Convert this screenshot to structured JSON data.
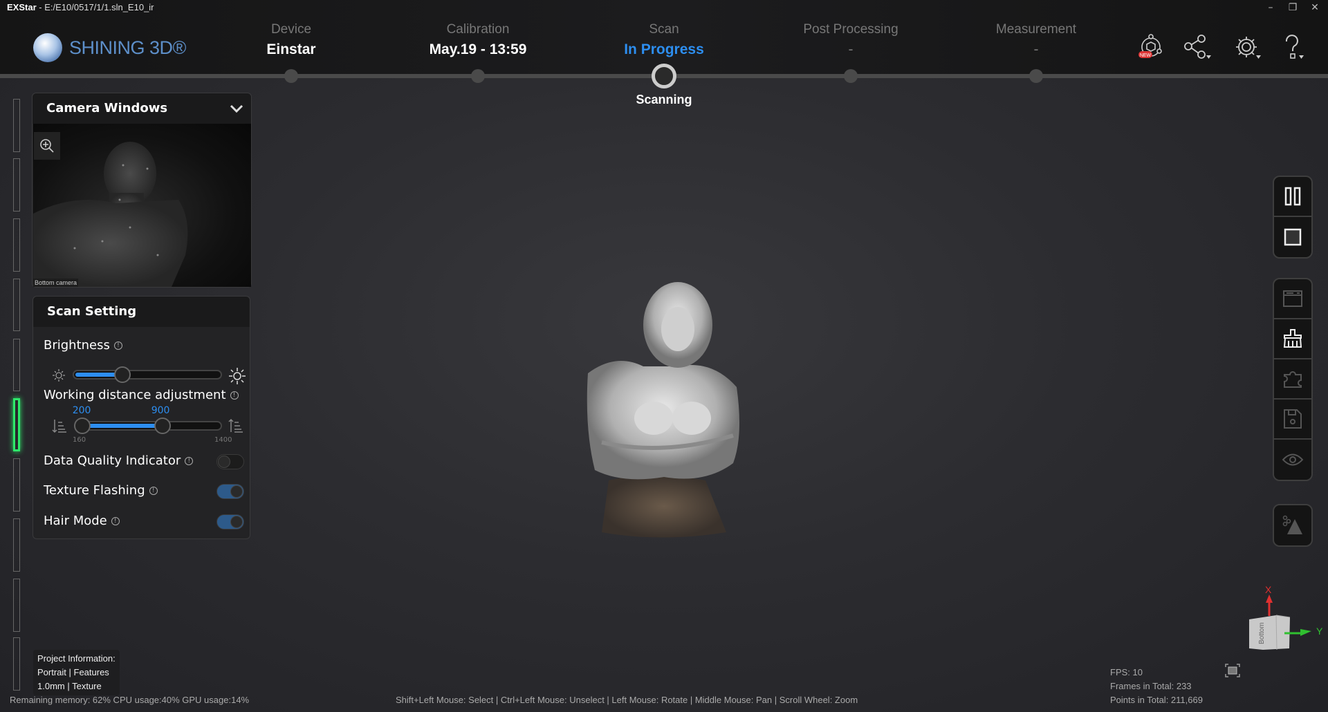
{
  "window": {
    "app": "EXStar",
    "separator": "-",
    "path": "E:/E10/0517/1/1.sln_E10_ir",
    "minimize": "–",
    "restore": "❐",
    "close": "✕"
  },
  "logo": {
    "text": "SHINING 3D®"
  },
  "steps": [
    {
      "label": "Device",
      "value": "Einstar"
    },
    {
      "label": "Calibration",
      "value": "May.19 - 13:59"
    },
    {
      "label": "Scan",
      "value": "In Progress",
      "sub": "Scanning"
    },
    {
      "label": "Post Processing",
      "value": "-"
    },
    {
      "label": "Measurement",
      "value": "-"
    }
  ],
  "toolbar": {
    "new_badge": "NEW",
    "icons": [
      "new-features-icon",
      "share-icon",
      "settings-icon",
      "help-icon"
    ]
  },
  "camera": {
    "title": "Camera Windows",
    "caption": "Bottom camera"
  },
  "scan_setting": {
    "title": "Scan Setting",
    "brightness": {
      "label": "Brightness",
      "value_fraction": 0.33
    },
    "working_distance": {
      "label": "Working distance adjustment",
      "min_label": "160",
      "max_label": "1400",
      "low": "200",
      "high": "900",
      "min": 160,
      "max": 1400
    },
    "toggles": [
      {
        "label": "Data Quality Indicator",
        "on": false
      },
      {
        "label": "Texture Flashing",
        "on": true
      },
      {
        "label": "Hair Mode",
        "on": true
      }
    ]
  },
  "project": {
    "line1": "Project Information:",
    "line2": "Portrait | Features",
    "line3": "1.0mm | Texture"
  },
  "status": {
    "resources": "Remaining memory: 62% CPU usage:40%  GPU usage:14%",
    "hints": "Shift+Left Mouse: Select | Ctrl+Left Mouse: Unselect | Left Mouse: Rotate | Middle Mouse: Pan | Scroll Wheel: Zoom"
  },
  "stats": {
    "fps": "FPS: 10",
    "frames": "Frames in Total: 233",
    "points": "Points in Total: 211,669"
  },
  "axis": {
    "x": "X",
    "y": "Y",
    "face": "Bottom"
  },
  "colors": {
    "accent": "#2d8ef0",
    "active_rail": "#2ee86a",
    "axis_x": "#e03030",
    "axis_y": "#30c030"
  }
}
